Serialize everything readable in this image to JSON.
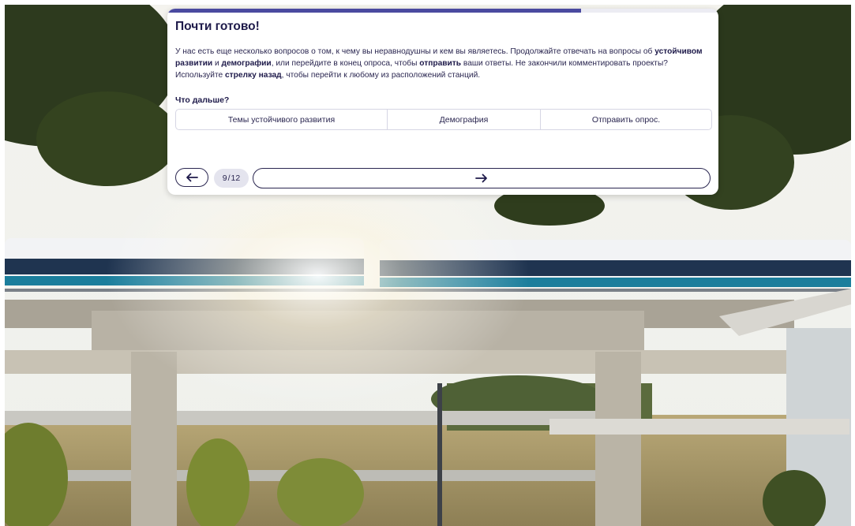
{
  "survey": {
    "title": "Почти готово!",
    "progress_fraction": 0.75,
    "intro_1": "У нас есть еще несколько вопросов о том, к чему вы неравнодушны и кем вы являетесь. Продолжайте отвечать на вопросы об ",
    "intro_bold_1": "устойчивом развитии",
    "intro_2": " и ",
    "intro_bold_2": "демографии",
    "intro_3": ", или перейдите в конец опроса, чтобы ",
    "intro_bold_3": "отправить",
    "intro_4": " ваши ответы. Не закончили комментировать проекты? Используйте ",
    "intro_bold_4": "стрелку назад",
    "intro_5": ", чтобы перейти к любому из расположений станций.",
    "next_label": "Что дальше?",
    "choices": [
      {
        "label": "Темы устойчивого развития"
      },
      {
        "label": "Демография"
      },
      {
        "label": "Отправить опрос."
      }
    ]
  },
  "navigation": {
    "current_page": "9",
    "separator": "/",
    "total_pages": "12",
    "back_icon": "arrow-left-icon",
    "forward_icon": "arrow-right-icon"
  },
  "colors": {
    "accent": "#4a4aa0",
    "text_dark": "#1e1a4a",
    "counter_bg": "#e4e4ee"
  }
}
